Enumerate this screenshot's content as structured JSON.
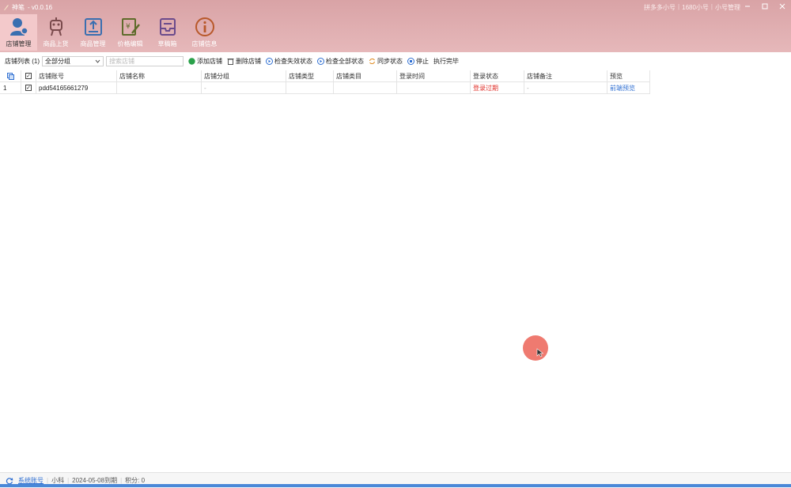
{
  "app": {
    "title": "神笔",
    "version": "- v0.0.16",
    "top_right": [
      "拼多多小号",
      "1680小号",
      "小号管理"
    ]
  },
  "nav": [
    {
      "label": "店铺管理",
      "icon": "store-manage-icon",
      "active": true
    },
    {
      "label": "商品上货",
      "icon": "upload-bot-icon",
      "active": false
    },
    {
      "label": "商品管理",
      "icon": "goods-manage-icon",
      "active": false
    },
    {
      "label": "价格编辑",
      "icon": "price-edit-icon",
      "active": false
    },
    {
      "label": "草稿箱",
      "icon": "drafts-icon",
      "active": false
    },
    {
      "label": "店铺信息",
      "icon": "info-icon",
      "active": false
    }
  ],
  "toolbar": {
    "store_list_label": "店铺列表 (1)",
    "group_select_value": "全部分组",
    "search_placeholder": "搜索店铺",
    "add_store": "添加店铺",
    "delete_store": "删除店铺",
    "check_failed_status": "检查失效状态",
    "check_all_status": "检查全部状态",
    "sync_status": "同步状态",
    "stop": "停止",
    "execute_done": "执行完毕"
  },
  "table": {
    "headers": [
      "店铺账号",
      "店铺名称",
      "店铺分组",
      "店铺类型",
      "店铺类目",
      "登录时间",
      "登录状态",
      "店铺备注",
      "预览"
    ],
    "rows": [
      {
        "index": "1",
        "checked": true,
        "account": "pdd54165661279",
        "name": "",
        "group": "-",
        "type": "",
        "category": "",
        "login_time": "",
        "login_status": "登录过期",
        "remark": "-",
        "preview": "前端预览"
      }
    ]
  },
  "statusbar": {
    "link": "系统账号",
    "user": "小科",
    "expiry": "2024-05-08到期",
    "points": "积分: 0"
  },
  "colors": {
    "titlebar": "#d9a3a6",
    "status_red": "#e0302a",
    "link_blue": "#2f6fd2"
  }
}
